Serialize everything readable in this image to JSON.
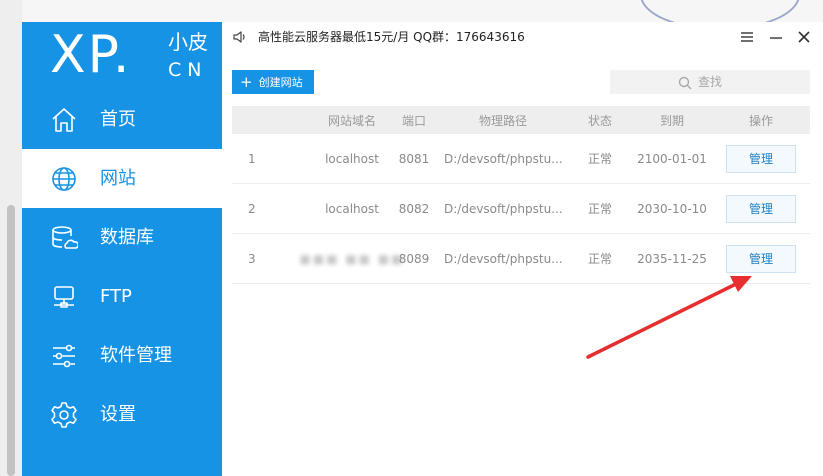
{
  "colors": {
    "brand": "#1793e6",
    "arrow": "#e62e2e",
    "manage_text": "#1f7fc4"
  },
  "logo": {
    "main": "XP.",
    "cn_top": "小皮",
    "cn_bottom": "CN"
  },
  "sidebar": {
    "items": [
      {
        "label": "首页",
        "icon": "home-icon",
        "active": false
      },
      {
        "label": "网站",
        "icon": "globe-icon",
        "active": true
      },
      {
        "label": "数据库",
        "icon": "database-icon",
        "active": false
      },
      {
        "label": "FTP",
        "icon": "server-icon",
        "active": false
      },
      {
        "label": "软件管理",
        "icon": "sliders-icon",
        "active": false
      },
      {
        "label": "设置",
        "icon": "gear-icon",
        "active": false
      }
    ]
  },
  "topbar": {
    "notice": "高性能云服务器最低15元/月  QQ群：176643616",
    "speaker_icon": "speaker-icon",
    "menu_icon": "menu-icon",
    "minimize_icon": "minimize-icon",
    "close_icon": "close-icon"
  },
  "toolbar": {
    "create_label": "创建网站",
    "create_icon": "plus-icon",
    "search_placeholder": "查找",
    "search_icon": "search-icon"
  },
  "table": {
    "headers": {
      "domain": "网站域名",
      "port": "端口",
      "path": "物理路径",
      "state": "状态",
      "expire": "到期",
      "action": "操作"
    },
    "rows": [
      {
        "index": "1",
        "domain": "localhost",
        "port": "8081",
        "path": "D:/devsoft/phpstu...",
        "state": "正常",
        "expire": "2100-01-01",
        "action": "管理",
        "blurred": false
      },
      {
        "index": "2",
        "domain": "localhost",
        "port": "8082",
        "path": "D:/devsoft/phpstu...",
        "state": "正常",
        "expire": "2030-10-10",
        "action": "管理",
        "blurred": false
      },
      {
        "index": "3",
        "domain": "",
        "port": "8089",
        "path": "D:/devsoft/phpstu...",
        "state": "正常",
        "expire": "2035-11-25",
        "action": "管理",
        "blurred": true
      }
    ]
  }
}
